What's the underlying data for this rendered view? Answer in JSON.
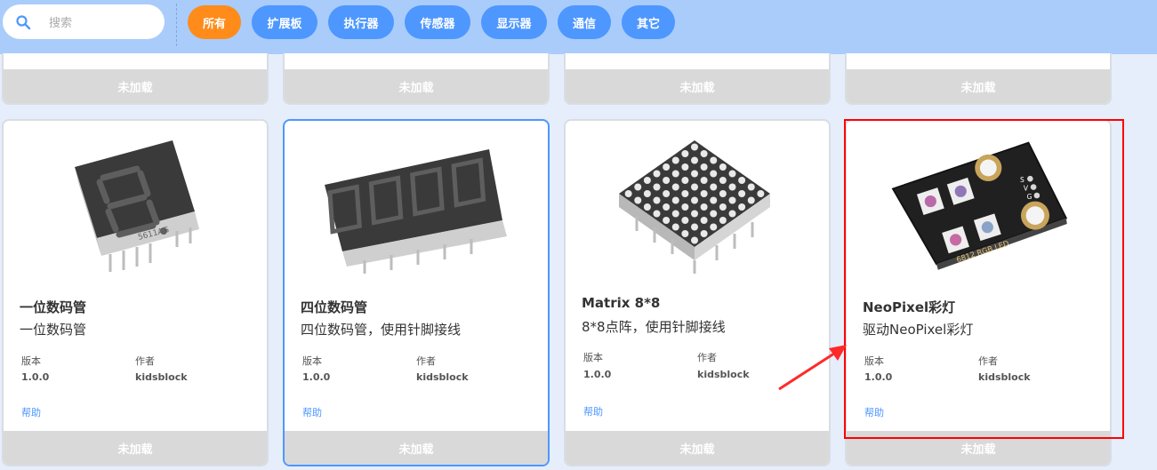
{
  "search": {
    "placeholder": "搜索"
  },
  "filters": [
    "所有",
    "扩展板",
    "执行器",
    "传感器",
    "显示器",
    "通信",
    "其它"
  ],
  "status_label": "未加载",
  "cards": [
    {
      "title": "一位数码管",
      "description": "一位数码管",
      "version_label": "版本",
      "version": "1.0.0",
      "author_label": "作者",
      "author": "kidsblock",
      "help": "帮助",
      "image_text": "5611AG"
    },
    {
      "title": "四位数码管",
      "description": "四位数码管，使用针脚接线",
      "version_label": "版本",
      "version": "1.0.0",
      "author_label": "作者",
      "author": "kidsblock",
      "help": "帮助"
    },
    {
      "title": "Matrix 8*8",
      "description": "8*8点阵，使用针脚接线",
      "version_label": "版本",
      "version": "1.0.0",
      "author_label": "作者",
      "author": "kidsblock",
      "help": "帮助"
    },
    {
      "title": "NeoPixel彩灯",
      "description": "驱动NeoPixel彩灯",
      "version_label": "版本",
      "version": "1.0.0",
      "author_label": "作者",
      "author": "kidsblock",
      "help": "帮助",
      "image_text": "6812 RGB LED",
      "pin_labels": [
        "S",
        "V",
        "G"
      ]
    }
  ],
  "colors": {
    "accent": "#4d97ff",
    "active_filter": "#ff8c1a",
    "highlight": "#ff0000"
  }
}
